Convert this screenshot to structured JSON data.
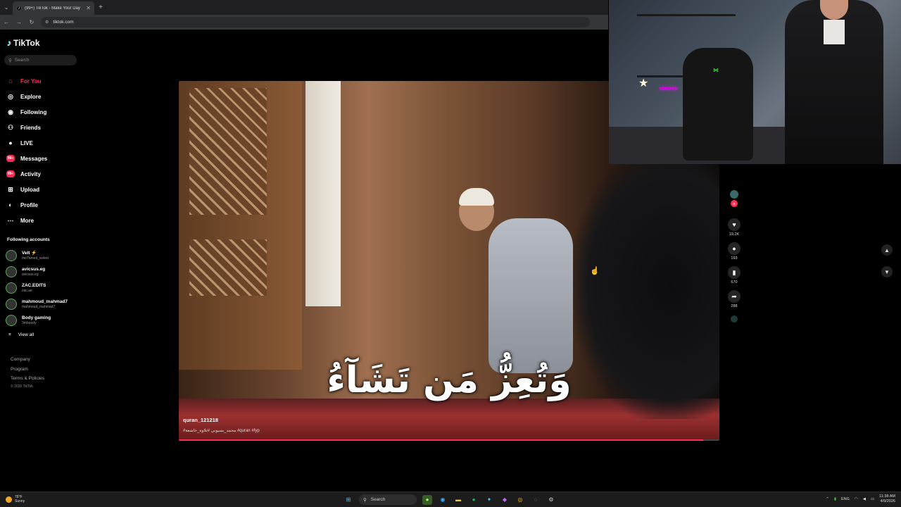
{
  "browser": {
    "tab_title": "(99+) TikTok - Make Your Day",
    "tab_close": "✕",
    "new_tab": "+",
    "url": "tiktok.com"
  },
  "sidebar": {
    "brand": "TikTok",
    "search_placeholder": "Search",
    "nav": [
      {
        "label": "For You",
        "icon": "home-icon",
        "glyph": "⌂",
        "active": true
      },
      {
        "label": "Explore",
        "icon": "compass-icon",
        "glyph": "◎"
      },
      {
        "label": "Following",
        "icon": "following-icon",
        "glyph": "◉"
      },
      {
        "label": "Friends",
        "icon": "friends-icon",
        "glyph": "⚇"
      },
      {
        "label": "LIVE",
        "icon": "live-icon",
        "glyph": "●"
      },
      {
        "label": "Messages",
        "icon": "messages-icon",
        "glyph": "✉",
        "badge": "99+"
      },
      {
        "label": "Activity",
        "icon": "activity-icon",
        "glyph": "♡",
        "badge": "99+"
      },
      {
        "label": "Upload",
        "icon": "upload-icon",
        "glyph": "⊞"
      },
      {
        "label": "Profile",
        "icon": "profile-icon",
        "glyph": "◐"
      },
      {
        "label": "More",
        "icon": "more-icon",
        "glyph": "⋯"
      }
    ],
    "following_heading": "Following accounts",
    "accounts": [
      {
        "name": "Velt ⚡",
        "handle": "mo7amed_wvled"
      },
      {
        "name": "avicsus.eg",
        "handle": "avicsus.eg"
      },
      {
        "name": "ZAC.EDITS",
        "handle": "zac.ae"
      },
      {
        "name": "mahmoud_mahmad7",
        "handle": "mahmoud_mahmad7"
      },
      {
        "name": "Body gaming",
        "handle": "3mboody"
      }
    ],
    "view_all": "View all",
    "footer": [
      "Company",
      "Program",
      "Terms & Policies"
    ],
    "copyright": "© 2026 TikTok"
  },
  "video": {
    "subtitle_arabic": "وَتُعِزُّ مَن تَشَآءُ",
    "author": "quran_121218",
    "caption": "#محمد_بسيوني #تلاوة_خاشعة #quran #fyp",
    "progress": 0.97
  },
  "actions": {
    "likes": "19.2K",
    "comments": "193",
    "saves": "670",
    "shares": "288"
  },
  "taskbar": {
    "temp": "76°F",
    "weather": "Sunny",
    "search": "Search",
    "lang": "ENG",
    "time": "11:38 AM",
    "date": "4/9/2026"
  }
}
